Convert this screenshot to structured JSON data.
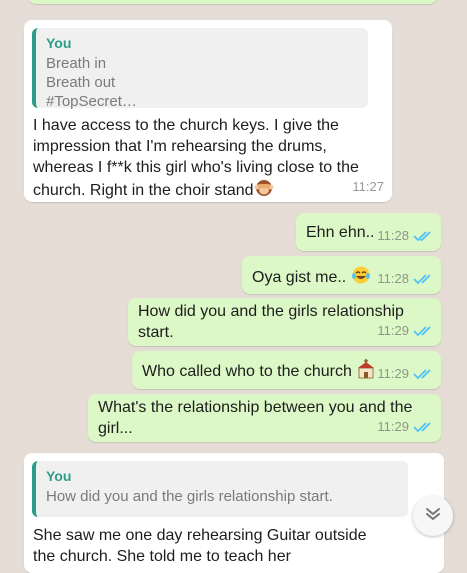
{
  "messages": {
    "m1": {
      "quote_sender": "You",
      "quote_lines": [
        "Breath in",
        "Breath out",
        "#TopSecret…"
      ],
      "text": "I have access to the church keys. I give the impression that I'm rehearsing the drums, whereas I f**k this girl who's living close to the church. Right in the choir stand",
      "emoji": "see-no-evil-monkey",
      "time": "11:27"
    },
    "m2": {
      "text": "Ehn ehn..",
      "time": "11:28"
    },
    "m3": {
      "text": "Oya gist me..",
      "emoji": "tears-of-joy",
      "time": "11:28"
    },
    "m4": {
      "text": "How did you and the girls relationship start.",
      "time": "11:29"
    },
    "m5": {
      "text": "Who called who to the church",
      "emoji": "church",
      "time": "11:29"
    },
    "m6": {
      "text": "What's the relationship between you and the girl...",
      "time": "11:29"
    },
    "m7": {
      "quote_sender": "You",
      "quote_text": "How did you and the girls relationship start.",
      "text": "She saw me one day rehearsing Guitar outside the church. She told me to teach her"
    }
  },
  "colors": {
    "background": "#e5ddd5",
    "incoming": "#ffffff",
    "outgoing": "#dcf8c6",
    "quote_accent": "#2d9c8b",
    "read_ticks": "#4fc3f7"
  },
  "icons": {
    "read_ticks": "double-check-icon",
    "scroll_down": "chevron-double-down-icon"
  }
}
